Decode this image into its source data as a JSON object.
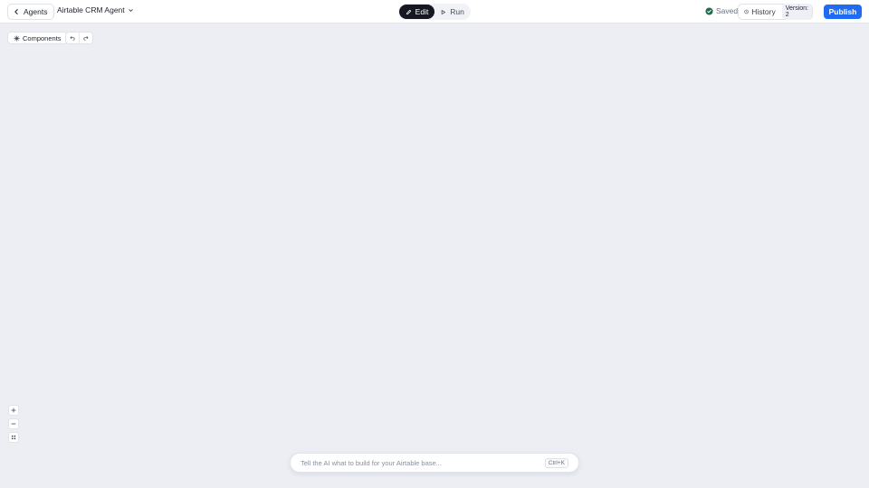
{
  "header": {
    "back_label": "Agents",
    "agent_name": "Airtable CRM Agent",
    "mode_edit": "Edit",
    "mode_run": "Run",
    "saved_label": "Saved",
    "history_label": "History",
    "version_label": "Version: 2",
    "publish_label": "Publish"
  },
  "canvas": {
    "components_label": "Components"
  },
  "prompt": {
    "placeholder": "Tell the AI what to build for your Airtable base...",
    "value": "",
    "shortcut": "Ctrl+K"
  },
  "colors": {
    "accent": "#1f6cf2",
    "edit_active": "#151821",
    "saved_check": "#1f6b4f",
    "canvas_bg": "#eceef4"
  },
  "icons": {
    "back": "chevron-left-icon",
    "agent_menu": "chevron-down-icon",
    "edit": "pencil-icon",
    "run": "play-icon",
    "saved": "check-circle-icon",
    "history": "clock-history-icon",
    "components": "sparkle-icon",
    "undo": "undo-icon",
    "redo": "redo-icon",
    "zoom_in": "plus-icon",
    "zoom_out": "minus-icon",
    "fit": "grid-icon"
  }
}
